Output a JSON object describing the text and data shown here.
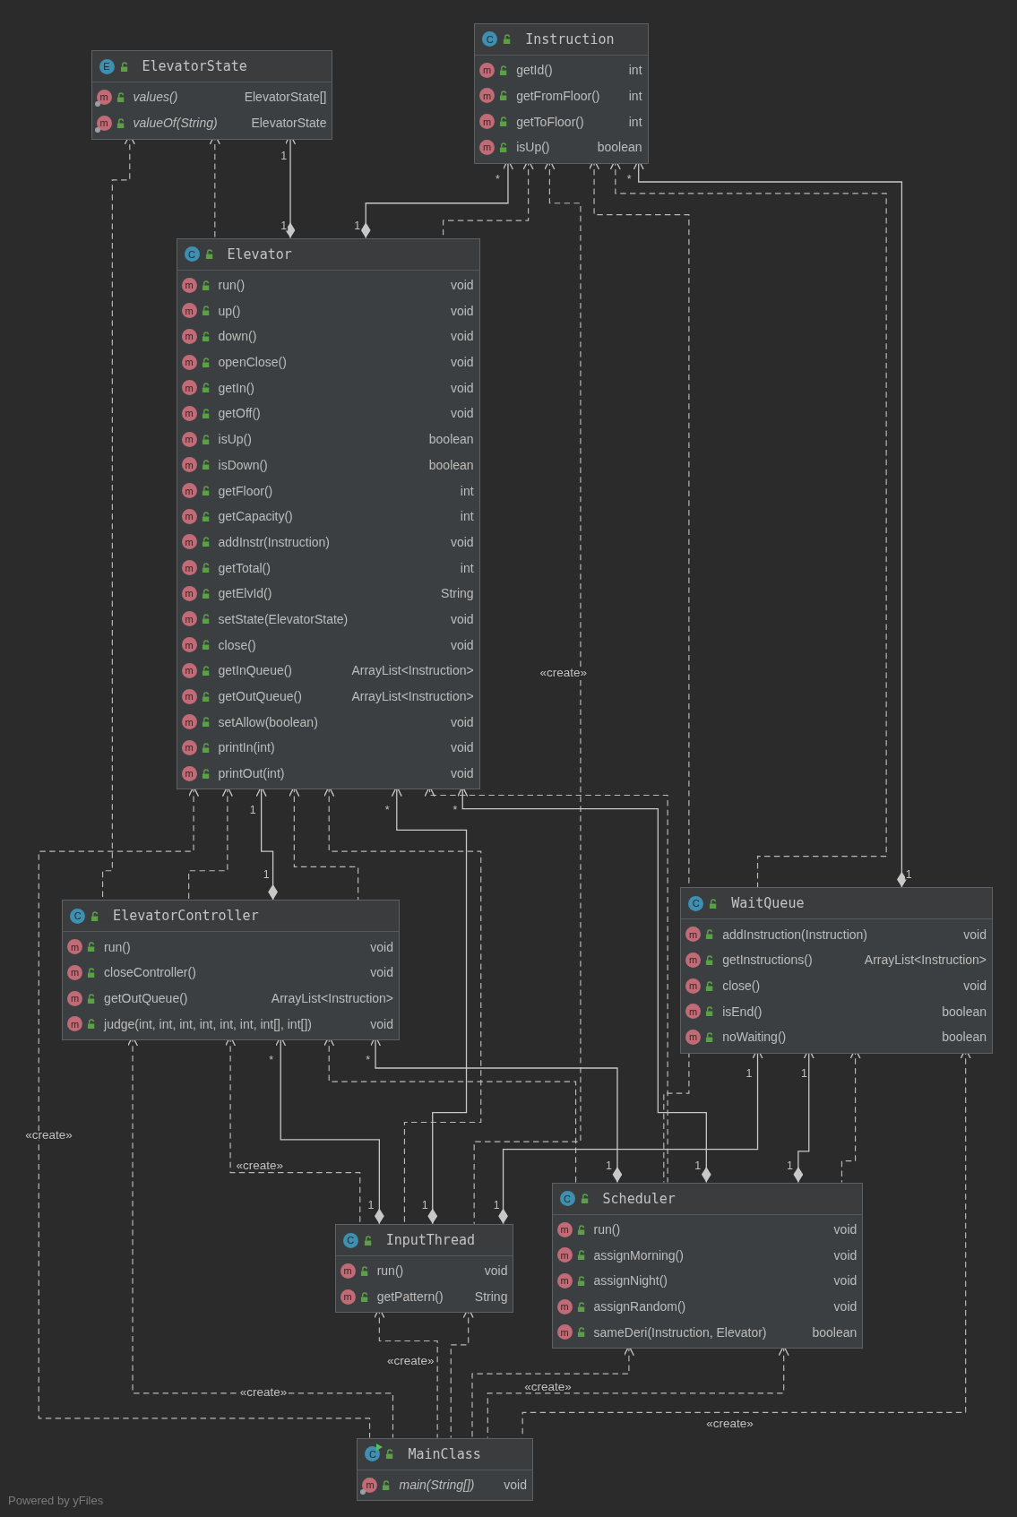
{
  "classes": [
    {
      "name": "ElevatorState",
      "kind": "enum",
      "badge": "E",
      "methods": [
        {
          "badge": "m",
          "name": "values()",
          "type": "ElevatorState[]",
          "static": true
        },
        {
          "badge": "m",
          "name": "valueOf(String)",
          "type": "ElevatorState",
          "static": true
        }
      ]
    },
    {
      "name": "Instruction",
      "kind": "class",
      "badge": "C",
      "methods": [
        {
          "badge": "m",
          "name": "getId()",
          "type": "int",
          "static": false
        },
        {
          "badge": "m",
          "name": "getFromFloor()",
          "type": "int",
          "static": false
        },
        {
          "badge": "m",
          "name": "getToFloor()",
          "type": "int",
          "static": false
        },
        {
          "badge": "m",
          "name": "isUp()",
          "type": "boolean",
          "static": false
        }
      ]
    },
    {
      "name": "Elevator",
      "kind": "class",
      "badge": "C",
      "methods": [
        {
          "badge": "m",
          "name": "run()",
          "type": "void",
          "static": false
        },
        {
          "badge": "m",
          "name": "up()",
          "type": "void",
          "static": false
        },
        {
          "badge": "m",
          "name": "down()",
          "type": "void",
          "static": false
        },
        {
          "badge": "m",
          "name": "openClose()",
          "type": "void",
          "static": false
        },
        {
          "badge": "m",
          "name": "getIn()",
          "type": "void",
          "static": false
        },
        {
          "badge": "m",
          "name": "getOff()",
          "type": "void",
          "static": false
        },
        {
          "badge": "m",
          "name": "isUp()",
          "type": "boolean",
          "static": false
        },
        {
          "badge": "m",
          "name": "isDown()",
          "type": "boolean",
          "static": false
        },
        {
          "badge": "m",
          "name": "getFloor()",
          "type": "int",
          "static": false
        },
        {
          "badge": "m",
          "name": "getCapacity()",
          "type": "int",
          "static": false
        },
        {
          "badge": "m",
          "name": "addInstr(Instruction)",
          "type": "void",
          "static": false
        },
        {
          "badge": "m",
          "name": "getTotal()",
          "type": "int",
          "static": false
        },
        {
          "badge": "m",
          "name": "getElvId()",
          "type": "String",
          "static": false
        },
        {
          "badge": "m",
          "name": "setState(ElevatorState)",
          "type": "void",
          "static": false
        },
        {
          "badge": "m",
          "name": "close()",
          "type": "void",
          "static": false
        },
        {
          "badge": "m",
          "name": "getInQueue()",
          "type": "ArrayList<Instruction>",
          "static": false
        },
        {
          "badge": "m",
          "name": "getOutQueue()",
          "type": "ArrayList<Instruction>",
          "static": false
        },
        {
          "badge": "m",
          "name": "setAllow(boolean)",
          "type": "void",
          "static": false
        },
        {
          "badge": "m",
          "name": "printIn(int)",
          "type": "void",
          "static": false
        },
        {
          "badge": "m",
          "name": "printOut(int)",
          "type": "void",
          "static": false
        }
      ]
    },
    {
      "name": "ElevatorController",
      "kind": "class",
      "badge": "C",
      "methods": [
        {
          "badge": "m",
          "name": "run()",
          "type": "void",
          "static": false
        },
        {
          "badge": "m",
          "name": "closeController()",
          "type": "void",
          "static": false
        },
        {
          "badge": "m",
          "name": "getOutQueue()",
          "type": "ArrayList<Instruction>",
          "static": false
        },
        {
          "badge": "m",
          "name": "judge(int, int, int, int, int, int, int[], int[])",
          "type": "void",
          "static": false
        }
      ]
    },
    {
      "name": "WaitQueue",
      "kind": "class",
      "badge": "C",
      "methods": [
        {
          "badge": "m",
          "name": "addInstruction(Instruction)",
          "type": "void",
          "static": false
        },
        {
          "badge": "m",
          "name": "getInstructions()",
          "type": "ArrayList<Instruction>",
          "static": false
        },
        {
          "badge": "m",
          "name": "close()",
          "type": "void",
          "static": false
        },
        {
          "badge": "m",
          "name": "isEnd()",
          "type": "boolean",
          "static": false
        },
        {
          "badge": "m",
          "name": "noWaiting()",
          "type": "boolean",
          "static": false
        }
      ]
    },
    {
      "name": "InputThread",
      "kind": "class",
      "badge": "C",
      "methods": [
        {
          "badge": "m",
          "name": "run()",
          "type": "void",
          "static": false
        },
        {
          "badge": "m",
          "name": "getPattern()",
          "type": "String",
          "static": false
        }
      ]
    },
    {
      "name": "Scheduler",
      "kind": "class",
      "badge": "C",
      "methods": [
        {
          "badge": "m",
          "name": "run()",
          "type": "void",
          "static": false
        },
        {
          "badge": "m",
          "name": "assignMorning()",
          "type": "void",
          "static": false
        },
        {
          "badge": "m",
          "name": "assignNight()",
          "type": "void",
          "static": false
        },
        {
          "badge": "m",
          "name": "assignRandom()",
          "type": "void",
          "static": false
        },
        {
          "badge": "m",
          "name": "sameDeri(Instruction, Elevator)",
          "type": "boolean",
          "static": false
        }
      ]
    },
    {
      "name": "MainClass",
      "kind": "main",
      "badge": "C",
      "methods": [
        {
          "badge": "m",
          "name": "main(String[])",
          "type": "void",
          "static": true
        }
      ]
    }
  ],
  "edges": [
    {
      "kind": "dependency"
    },
    {
      "kind": "composition"
    },
    {
      "kind": "composition"
    },
    {
      "kind": "dependency"
    },
    {
      "kind": "composition"
    },
    {
      "kind": "dependency"
    },
    {
      "kind": "dependency"
    },
    {
      "kind": "dependency"
    },
    {
      "kind": "dependency"
    },
    {
      "kind": "composition"
    },
    {
      "kind": "dependency"
    },
    {
      "kind": "dependency"
    },
    {
      "kind": "composition"
    },
    {
      "kind": "composition"
    },
    {
      "kind": "dependency"
    },
    {
      "kind": "dependency"
    },
    {
      "kind": "dependency"
    },
    {
      "kind": "composition"
    },
    {
      "kind": "composition"
    },
    {
      "kind": "dependency"
    },
    {
      "kind": "composition"
    },
    {
      "kind": "composition"
    },
    {
      "kind": "dependency"
    },
    {
      "kind": "dependency"
    },
    {
      "kind": "dependency"
    },
    {
      "kind": "dependency"
    },
    {
      "kind": "dependency"
    },
    {
      "kind": "dependency"
    },
    {
      "kind": "dependency"
    },
    {
      "kind": "dependency"
    }
  ],
  "edge_labels": [
    {
      "kind": "multiplicity",
      "text": "1"
    },
    {
      "kind": "multiplicity",
      "text": "*"
    },
    {
      "kind": "multiplicity",
      "text": "*"
    },
    {
      "kind": "multiplicity",
      "text": "1"
    },
    {
      "kind": "multiplicity",
      "text": "1"
    },
    {
      "kind": "stereotype",
      "text": "«create»"
    },
    {
      "kind": "multiplicity",
      "text": "1"
    },
    {
      "kind": "multiplicity",
      "text": "*"
    },
    {
      "kind": "multiplicity",
      "text": "*"
    },
    {
      "kind": "multiplicity",
      "text": "1"
    },
    {
      "kind": "multiplicity",
      "text": "1"
    },
    {
      "kind": "multiplicity",
      "text": "*"
    },
    {
      "kind": "multiplicity",
      "text": "*"
    },
    {
      "kind": "multiplicity",
      "text": "1"
    },
    {
      "kind": "multiplicity",
      "text": "1"
    },
    {
      "kind": "stereotype",
      "text": "«create»"
    },
    {
      "kind": "stereotype",
      "text": "«create»"
    },
    {
      "kind": "multiplicity",
      "text": "1"
    },
    {
      "kind": "multiplicity",
      "text": "1"
    },
    {
      "kind": "multiplicity",
      "text": "1"
    },
    {
      "kind": "multiplicity",
      "text": "1"
    },
    {
      "kind": "multiplicity",
      "text": "1"
    },
    {
      "kind": "multiplicity",
      "text": "1"
    },
    {
      "kind": "stereotype",
      "text": "«create»"
    },
    {
      "kind": "stereotype",
      "text": "«create»"
    },
    {
      "kind": "stereotype",
      "text": "«create»"
    },
    {
      "kind": "stereotype",
      "text": "«create»"
    }
  ],
  "footer": "Powered by yFiles"
}
